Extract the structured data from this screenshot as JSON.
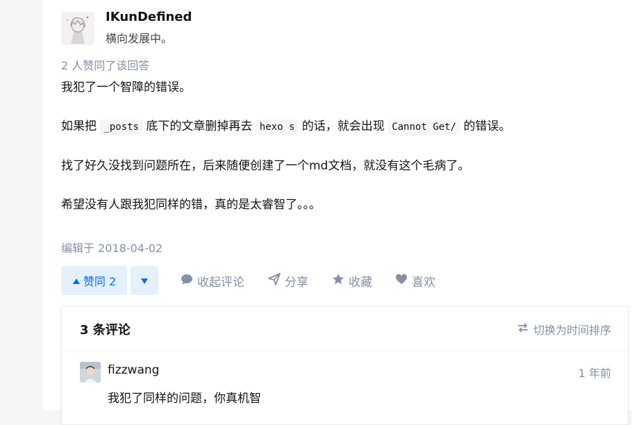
{
  "author": {
    "name": "IKunDefined",
    "bio": "横向发展中。"
  },
  "vote_summary": "2 人赞同了该回答",
  "answer": {
    "line1": "我犯了一个智障的错误。",
    "line2_prefix": "如果把",
    "line2_code1": "_posts",
    "line2_mid1": "底下的文章删掉再去",
    "line2_code2": "hexo s",
    "line2_mid2": "的话，就会出现",
    "line2_code3": "Cannot Get/",
    "line2_suffix": "的错误。",
    "line3": "找了好久没找到问题所在，后来随便创建了一个md文档，就没有这个毛病了。",
    "line4": "希望没有人跟我犯同样的错，真的是太睿智了。。。"
  },
  "edited": "编辑于 2018-04-02",
  "actions": {
    "vote_up": "赞同 2",
    "collapse_comments": "收起评论",
    "share": "分享",
    "favorite": "收藏",
    "like": "喜欢"
  },
  "comments": {
    "count_label": "3 条评论",
    "sort_label": "切换为时间排序",
    "items": [
      {
        "author": "fizzwang",
        "time": "1 年前",
        "text": "我犯了同样的问题，你真机智"
      }
    ]
  },
  "colors": {
    "accent": "#056de8",
    "accent_bg": "#e5f0fd",
    "muted": "#8590a6"
  },
  "icons": [
    "triangle-up-icon",
    "triangle-down-icon",
    "comment-icon",
    "share-icon",
    "star-icon",
    "heart-icon",
    "swap-icon"
  ]
}
